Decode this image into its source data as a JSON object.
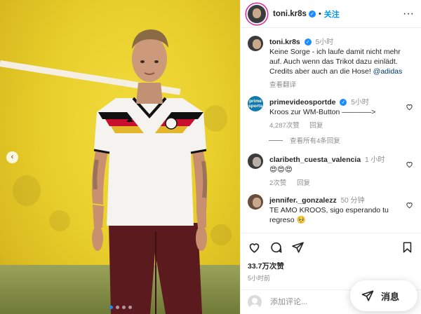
{
  "post": {
    "username": "toni.kr8s",
    "follow_label": "关注",
    "more_label": "···",
    "caption_time": "5小时",
    "caption_text": "Keine Sorge - ich laufe damit nicht mehr auf. Auch wenn das Trikot dazu einlädt. Credits aber auch an die Hose! ",
    "caption_mention": "@adidas",
    "caption_translate": "查看翻译",
    "likes": "33.7万次赞",
    "posted_ago": "5小时前",
    "comment_placeholder": "添加评论...",
    "messages_label": "消息",
    "carousel": {
      "slide_count": 4,
      "current_slide": 1
    }
  },
  "comments": [
    {
      "user": "primevideosportde",
      "verified": true,
      "time": "5小时",
      "text": "Kroos zur WM-Button ————>",
      "likes": "4,287次赞",
      "reply_label": "回复",
      "avatar_text_1": "prime",
      "avatar_text_2": "sports"
    },
    {
      "user": "claribeth_cuesta_valencia",
      "verified": false,
      "time": "1 小时",
      "text": "😍😍😍",
      "likes": "2次赞",
      "reply_label": "回复"
    },
    {
      "user": "jennifer._gonzalezz",
      "verified": false,
      "time": "50 分钟",
      "text": "TE AMO KROOS, sigo esperando tu regreso 🥺",
      "likes": "",
      "reply_label": ""
    }
  ],
  "view_replies": "查看所有4条回复",
  "icons": {
    "like": "heart-icon",
    "comment": "comment-icon",
    "share": "share-icon",
    "save": "bookmark-icon",
    "messages": "paper-plane-icon",
    "prev": "chevron-left-icon",
    "more": "more-icon"
  },
  "colors": {
    "accent": "#0095f6",
    "verified": "#1a8cff",
    "text": "#262626",
    "muted": "#8e8e8e",
    "mention": "#00376b",
    "wall": "#e9cf2c"
  }
}
